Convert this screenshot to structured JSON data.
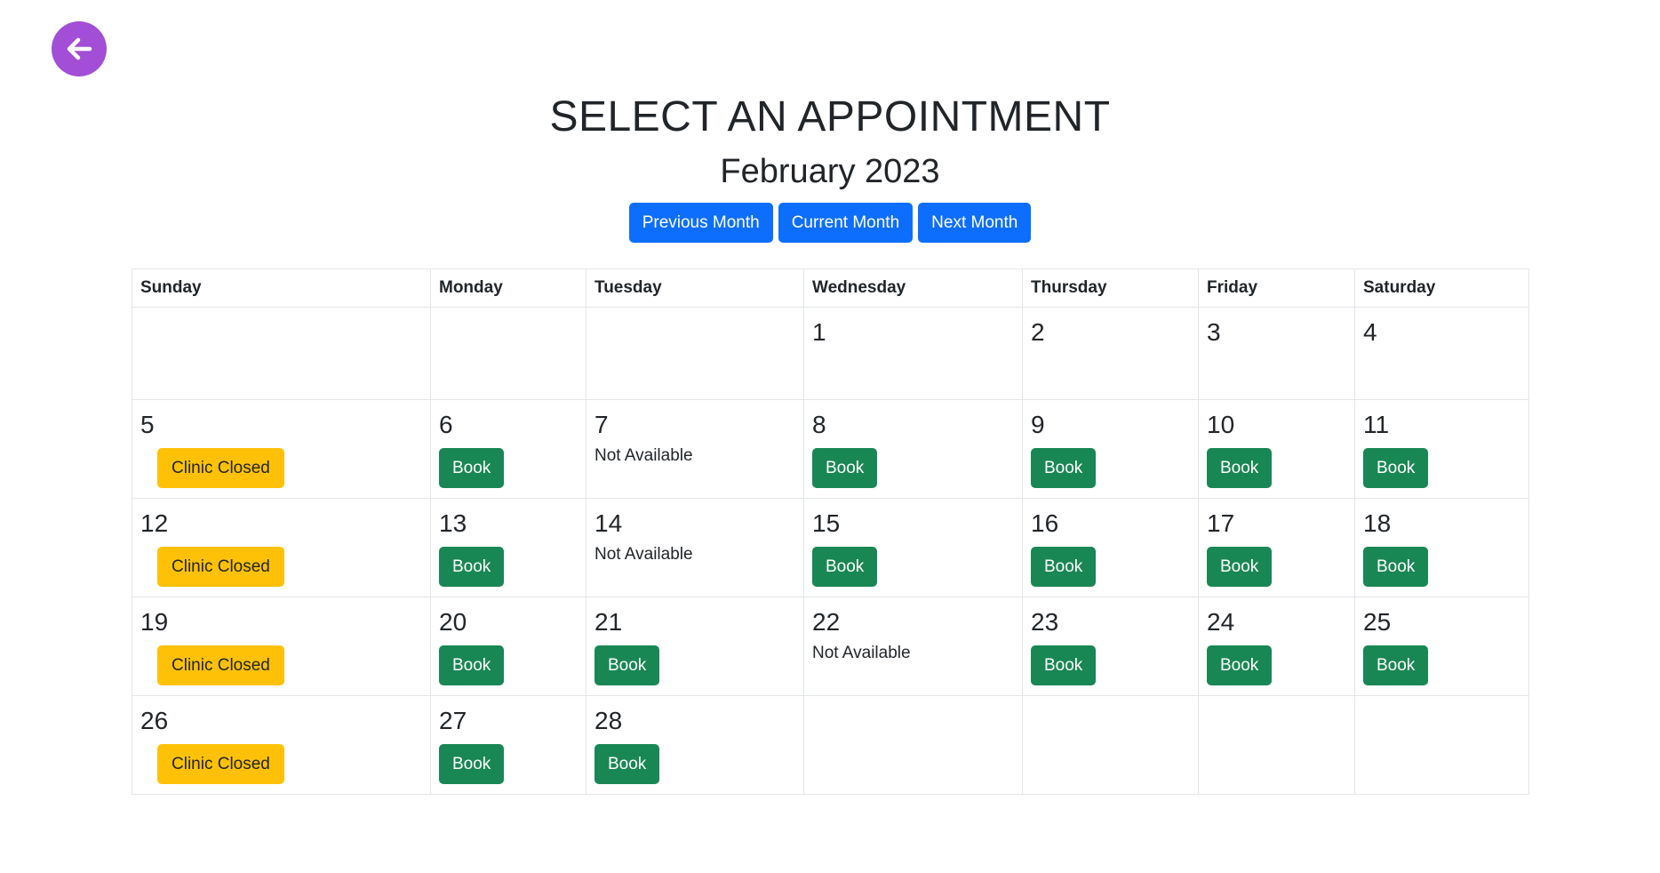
{
  "header": {
    "back_icon": "arrow-left-circle-icon",
    "title": "SELECT AN APPOINTMENT",
    "month": "February 2023"
  },
  "nav": {
    "previous_label": "Previous Month",
    "current_label": "Current Month",
    "next_label": "Next Month"
  },
  "colors": {
    "back_button": "#a24ed6",
    "nav_button": "#0d6efd",
    "book_button": "#198754",
    "closed_button": "#ffc107"
  },
  "calendar": {
    "weekdays": [
      "Sunday",
      "Monday",
      "Tuesday",
      "Wednesday",
      "Thursday",
      "Friday",
      "Saturday"
    ],
    "weeks": [
      [
        {
          "day": "",
          "status": ""
        },
        {
          "day": "",
          "status": ""
        },
        {
          "day": "",
          "status": ""
        },
        {
          "day": "1",
          "status": ""
        },
        {
          "day": "2",
          "status": ""
        },
        {
          "day": "3",
          "status": ""
        },
        {
          "day": "4",
          "status": ""
        }
      ],
      [
        {
          "day": "5",
          "status": "Clinic Closed"
        },
        {
          "day": "6",
          "status": "Book"
        },
        {
          "day": "7",
          "status": "Not Available"
        },
        {
          "day": "8",
          "status": "Book"
        },
        {
          "day": "9",
          "status": "Book"
        },
        {
          "day": "10",
          "status": "Book"
        },
        {
          "day": "11",
          "status": "Book"
        }
      ],
      [
        {
          "day": "12",
          "status": "Clinic Closed"
        },
        {
          "day": "13",
          "status": "Book"
        },
        {
          "day": "14",
          "status": "Not Available"
        },
        {
          "day": "15",
          "status": "Book"
        },
        {
          "day": "16",
          "status": "Book"
        },
        {
          "day": "17",
          "status": "Book"
        },
        {
          "day": "18",
          "status": "Book"
        }
      ],
      [
        {
          "day": "19",
          "status": "Clinic Closed"
        },
        {
          "day": "20",
          "status": "Book"
        },
        {
          "day": "21",
          "status": "Book"
        },
        {
          "day": "22",
          "status": "Not Available"
        },
        {
          "day": "23",
          "status": "Book"
        },
        {
          "day": "24",
          "status": "Book"
        },
        {
          "day": "25",
          "status": "Book"
        }
      ],
      [
        {
          "day": "26",
          "status": "Clinic Closed"
        },
        {
          "day": "27",
          "status": "Book"
        },
        {
          "day": "28",
          "status": "Book"
        },
        {
          "day": "",
          "status": ""
        },
        {
          "day": "",
          "status": ""
        },
        {
          "day": "",
          "status": ""
        },
        {
          "day": "",
          "status": ""
        }
      ]
    ]
  }
}
